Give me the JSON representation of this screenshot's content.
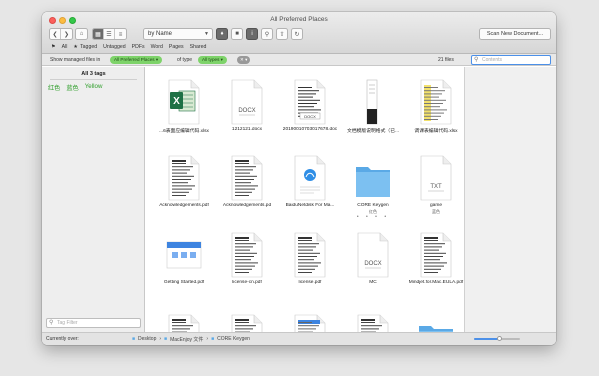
{
  "window": {
    "title": "All Preferred Places"
  },
  "toolbar": {
    "sort_value": "by Name",
    "scan_button": "Scan New Document..."
  },
  "filters": [
    "All",
    "Tagged",
    "Untagged",
    "PDFs",
    "Word",
    "Pages",
    "Shared"
  ],
  "showbar": {
    "prefix": "Show managed files in",
    "place": "All Preferred Places",
    "of_type": "of type",
    "type": "All types",
    "files_count": "21 files",
    "search_placeholder": "Contents"
  },
  "sidebar": {
    "tags_header": "All 3 tags",
    "tags": [
      "红色",
      "蓝色",
      "Yellow"
    ],
    "filter_placeholder": "Tag Filter"
  },
  "files": [
    {
      "name": "...6表面应编辑代码.xlsx",
      "kind": "excel"
    },
    {
      "name": "1212121.docx",
      "kind": "docx",
      "badge": "DOCX"
    },
    {
      "name": "20190010703017678.doc",
      "kind": "doc-scan",
      "badge": "DOCX"
    },
    {
      "name": "文档模版说明格式（已...",
      "kind": "narrow"
    },
    {
      "name": "调课表编辑代码.xlsx",
      "kind": "yellow-doc"
    },
    {
      "name": "Acknowledgements.pdf",
      "kind": "pdf"
    },
    {
      "name": "Acknowledgements.pd",
      "kind": "pdf"
    },
    {
      "name": "BaiduNetdisk For Ma...",
      "kind": "baidu"
    },
    {
      "name": "CORE Keygen",
      "kind": "folder",
      "sub": "红色",
      "dots": "• • • •"
    },
    {
      "name": "game",
      "kind": "txt",
      "badge": "TXT",
      "sub": "蓝色"
    },
    {
      "name": "Getting Started.pdf",
      "kind": "getting"
    },
    {
      "name": "license-cn.pdf",
      "kind": "pdf"
    },
    {
      "name": "license.pdf",
      "kind": "pdf"
    },
    {
      "name": "MC",
      "kind": "docx",
      "badge": "DOCX"
    },
    {
      "name": "Mindjet.for.Mac.EULA.pdf",
      "kind": "pdf"
    },
    {
      "name": "",
      "kind": "pdf"
    },
    {
      "name": "",
      "kind": "pdf"
    },
    {
      "name": "",
      "kind": "blue-doc"
    },
    {
      "name": "",
      "kind": "pdf"
    },
    {
      "name": "",
      "kind": "folder"
    }
  ],
  "status": {
    "current_label": "Currently over:",
    "breadcrumb": [
      "Desktop",
      "MacEnjoy 文件",
      "CORE Keygen"
    ]
  },
  "zoom_level": 0.55,
  "colors": {
    "accent": "#4c90e8",
    "tag_green": "#2e9e2a",
    "pill_green": "#7ed36a",
    "folder_blue": "#5aa9e6",
    "excel_green": "#1e7145"
  }
}
